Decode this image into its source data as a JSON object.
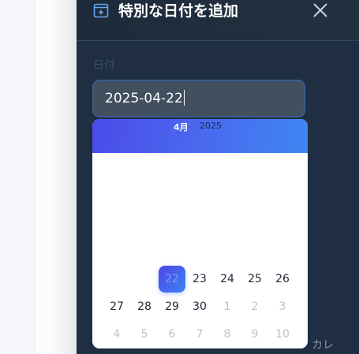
{
  "modal": {
    "title": "特別な日付を追加",
    "date_field_label": "日付",
    "date_value": "2025-04-22",
    "side_label": "カレ"
  },
  "calendar": {
    "month_label": "4月",
    "year_label": "2025",
    "week1": [
      "22",
      "23",
      "24",
      "25",
      "26"
    ],
    "week2": [
      "27",
      "28",
      "29",
      "30",
      "1",
      "2",
      "3"
    ],
    "week3": [
      "4",
      "5",
      "6",
      "7",
      "8",
      "9",
      "10"
    ],
    "selected_day": "22"
  },
  "icons": {
    "add_date": "calendar-plus-icon",
    "close": "close-icon"
  },
  "colors": {
    "modal_bg": "#1f2e42",
    "accent_start": "#4f46e5",
    "accent_end": "#3b82f6",
    "muted_day": "#b9c2cf"
  }
}
